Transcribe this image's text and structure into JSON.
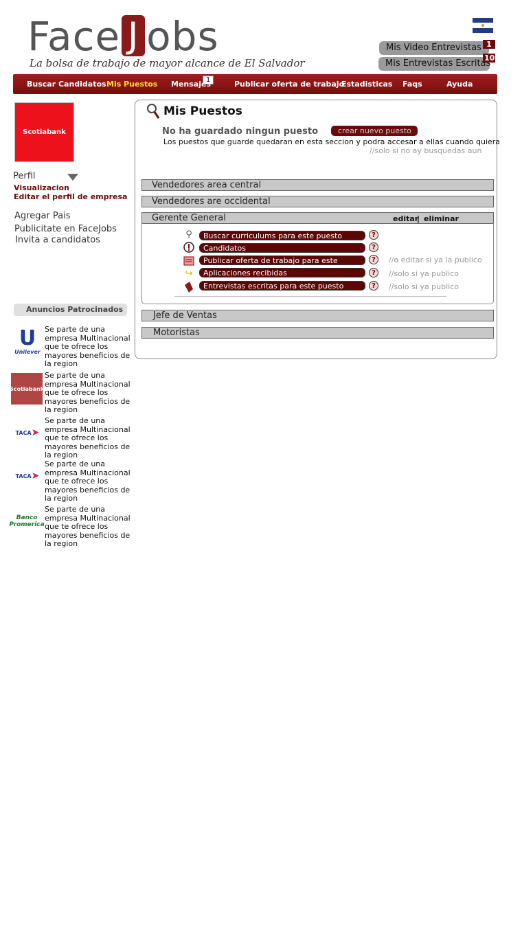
{
  "header": {
    "logo_text_left": "Face",
    "logo_text_j": "J",
    "logo_text_right": "obs",
    "tagline": "La bolsa de trabajo de mayor alcance de El Salvador",
    "video_entrevistas": {
      "label": "Mis Video Entrevistas",
      "count": "1"
    },
    "entrevistas_escritas": {
      "label": "Mis Entrevistas Escritas",
      "count": "10"
    }
  },
  "nav": {
    "items": [
      "Buscar Candidatos",
      "Mis Puestos",
      "Mensajes",
      "Publicar oferta de trabajo",
      "Estadisticas",
      "Faqs",
      "Ayuda"
    ],
    "mensajes_badge": "1",
    "active": "Mis Puestos"
  },
  "sidebar": {
    "company_logo": "Scotiabank",
    "perfil": "Perfil",
    "visualizacion": "Visualizacion",
    "editar": "Editar el perfil de empresa",
    "links": [
      "Agregar Pais",
      "Publicitate en FaceJobs",
      "Invita a candidatos"
    ],
    "anuncios_title": "Anuncios Patrocinados",
    "ads": [
      {
        "logo": "Unilever",
        "text": "Se parte de una empresa Multinacional que te ofrece los mayores beneficios de la region"
      },
      {
        "logo": "Scotiabank",
        "text": "Se parte de una empresa Multinacional que te ofrece los mayores beneficios de la region"
      },
      {
        "logo": "TACA",
        "text": "Se parte de una empresa Multinacional que te ofrece los mayores beneficios de la region"
      },
      {
        "logo": "TACA",
        "text": "Se parte de una empresa Multinacional que te ofrece los mayores beneficios de la region"
      },
      {
        "logo": "Banco Promerica",
        "text": "Se parte de una empresa Multinacional que te ofrece los mayores beneficios de la region"
      }
    ]
  },
  "main": {
    "title": "Mis Puestos",
    "empty_msg": "No ha guardado ningun puesto",
    "crear_btn": "crear nuevo puesto",
    "desc": "Los puestos  que guarde quedaran en esta seccion y podra accesar a ellas cuando quiera",
    "note_top": "//solo si no ay busquedas aun",
    "puestos": [
      "Vendedores area central",
      "Vendedores are occidental",
      "Gerente General",
      "Jefe de Ventas",
      "Motoristas"
    ],
    "editar": "editar",
    "sep": "|",
    "eliminar": "eliminar",
    "actions": [
      {
        "label": "Buscar curriculums  para este puesto",
        "icon": "magnifier-icon",
        "note": ""
      },
      {
        "label": "Candidatos",
        "icon": "exclamation-icon",
        "note": ""
      },
      {
        "label": "Publicar oferta de trabajo para este puesto",
        "icon": "document-icon",
        "note": "//o editar si ya la publico"
      },
      {
        "label": "Aplicaciones recibidas",
        "icon": "arrow-icon",
        "note": "//solo si ya publico"
      },
      {
        "label": "Entrevistas escritas para este puesto",
        "icon": "pencil-icon",
        "note": "//solo si ya publico"
      }
    ],
    "help_glyph": "?"
  }
}
